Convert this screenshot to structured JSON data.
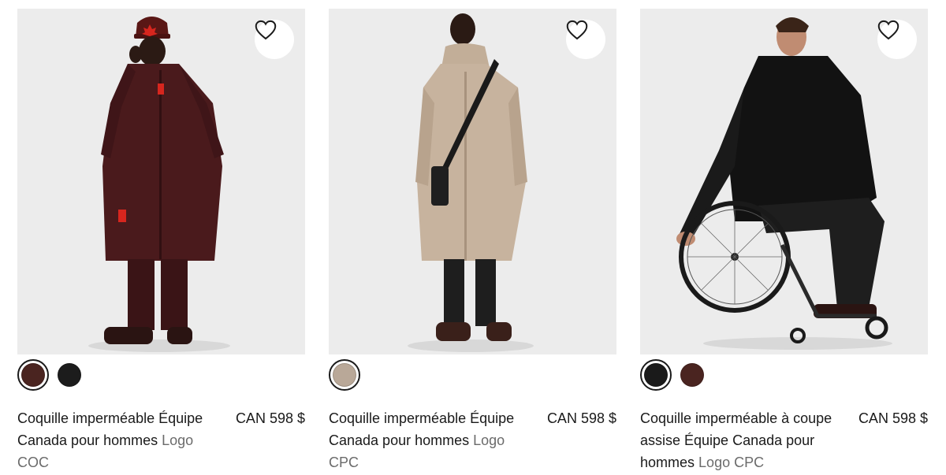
{
  "products": [
    {
      "name": "Coquille imperméable Équipe Canada pour hommes",
      "collection": "Logo COC",
      "price": "CAN 598 $",
      "wishlist_icon": "heart-outline-icon",
      "swatches": [
        {
          "color": "#4a2420",
          "selected": true
        },
        {
          "color": "#1c1c1c",
          "selected": false
        }
      ]
    },
    {
      "name": "Coquille imperméable Équipe Canada pour hommes",
      "collection": "Logo CPC",
      "price": "CAN 598 $",
      "wishlist_icon": "heart-outline-icon",
      "swatches": [
        {
          "color": "#b9a898",
          "selected": true
        }
      ]
    },
    {
      "name": "Coquille imperméable à coupe assise Équipe Canada pour hommes",
      "collection": "Logo CPC",
      "price": "CAN 598 $",
      "wishlist_icon": "heart-outline-icon",
      "swatches": [
        {
          "color": "#1a1a1a",
          "selected": true
        },
        {
          "color": "#4a2420",
          "selected": false
        }
      ]
    }
  ]
}
